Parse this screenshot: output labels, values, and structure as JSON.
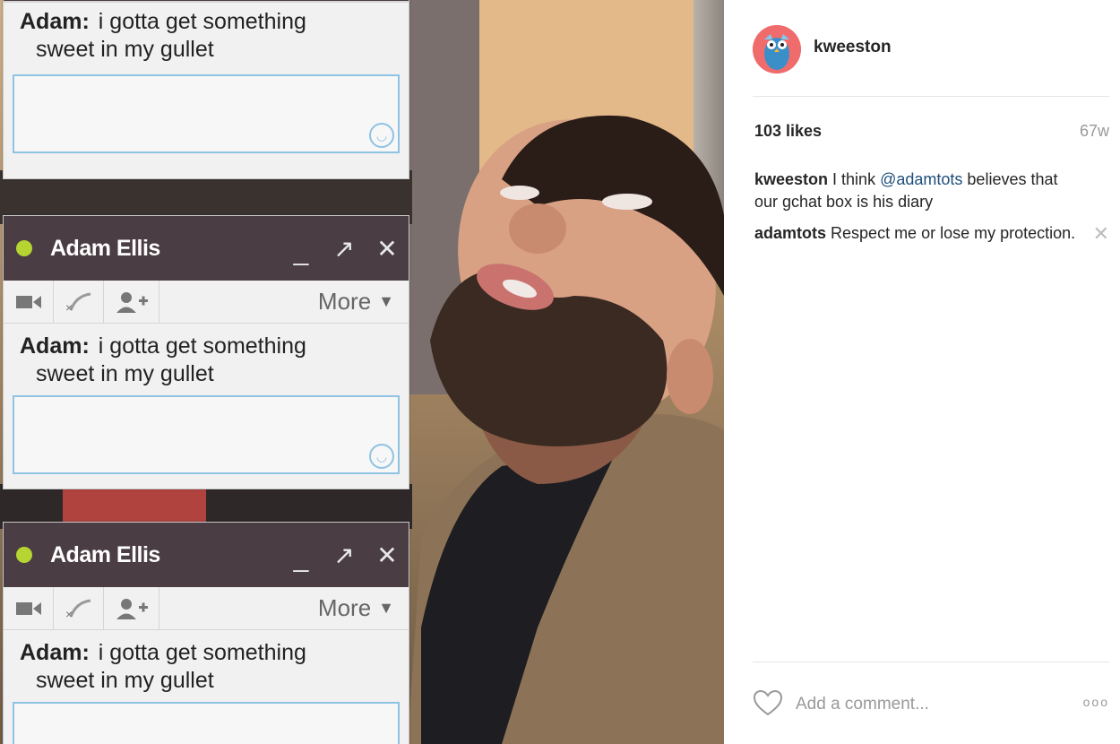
{
  "chat_windows": [
    {
      "contact_name": "",
      "sender": "Adam:",
      "message_line1": "i gotta get something",
      "message_line2": "sweet in my gullet"
    },
    {
      "contact_name": "Adam Ellis",
      "sender": "Adam:",
      "message_line1": "i gotta get something",
      "message_line2": "sweet in my gullet"
    },
    {
      "contact_name": "Adam Ellis",
      "sender": "Adam:",
      "message_line1": "i gotta get something",
      "message_line2": "sweet in my gullet"
    }
  ],
  "chat_toolbar": {
    "more_label": "More",
    "more_caret": "▼"
  },
  "chat_controls": {
    "minimize": "_",
    "popout": "↗",
    "close": "✕"
  },
  "post": {
    "username": "kweeston",
    "likes": "103 likes",
    "time_ago": "67w",
    "caption": {
      "user": "kweeston",
      "text_before": "I think",
      "mention": "@adamtots",
      "text_after": "believes that our gchat box is his diary"
    },
    "comments": [
      {
        "user": "adamtots",
        "text": "Respect me or lose my protection."
      }
    ],
    "add_comment_placeholder": "Add a comment...",
    "more_options": "ooo"
  },
  "colors": {
    "chat_header": "#4a3d43",
    "status_online": "#b6d432",
    "input_border": "#8fc3e3",
    "mention_link": "#1f4e7a"
  }
}
